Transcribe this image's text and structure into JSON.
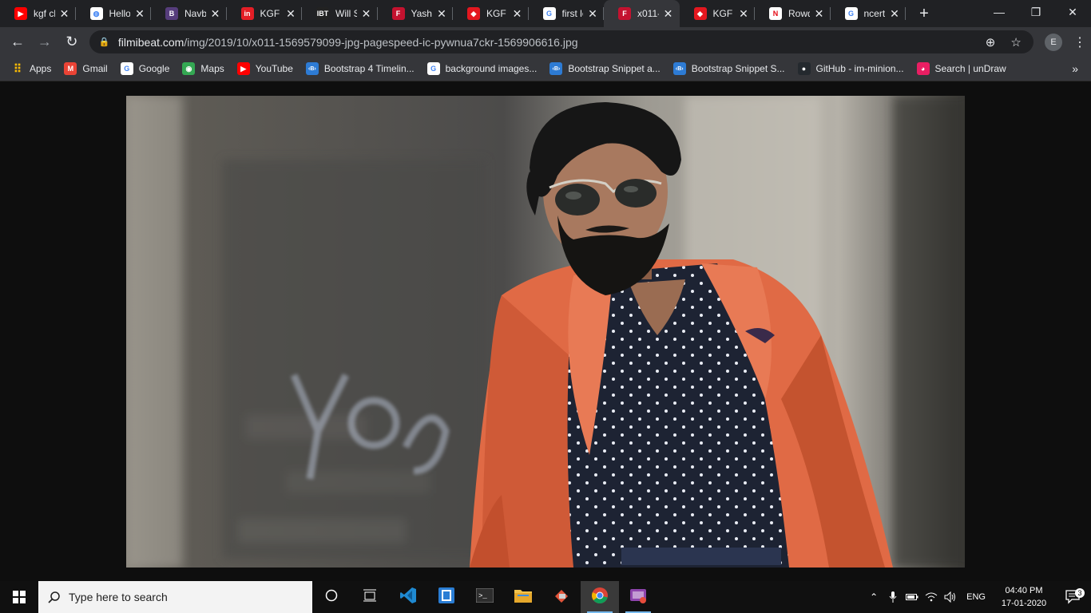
{
  "tabs": [
    {
      "title": "kgf ch",
      "icon": "youtube-icon",
      "color": "#ff0000",
      "glyph": "▶",
      "active": false
    },
    {
      "title": "Hello",
      "icon": "globe-icon",
      "color": "#ffffff",
      "glyph": "◍",
      "active": false
    },
    {
      "title": "Navb",
      "icon": "bootstrap-icon",
      "color": "#563d7c",
      "glyph": "B",
      "active": false
    },
    {
      "title": "KGF C",
      "icon": "indiatoday-icon",
      "color": "#e41e26",
      "glyph": "in",
      "active": false
    },
    {
      "title": "Will S",
      "icon": "ibt-icon",
      "color": "#222222",
      "glyph": "IBT",
      "active": false
    },
    {
      "title": "Yash C",
      "icon": "filmibeat-icon",
      "color": "#c4122f",
      "glyph": "F",
      "active": false
    },
    {
      "title": "KGF C",
      "icon": "news-icon",
      "color": "#e3171f",
      "glyph": "◆",
      "active": false
    },
    {
      "title": "first lc",
      "icon": "google-icon",
      "color": "#ffffff",
      "glyph": "G",
      "active": false
    },
    {
      "title": "x011-",
      "icon": "filmibeat-icon",
      "color": "#c4122f",
      "glyph": "F",
      "active": true
    },
    {
      "title": "KGF C",
      "icon": "news-icon",
      "color": "#e3171f",
      "glyph": "◆",
      "active": false
    },
    {
      "title": "Rowd",
      "icon": "netflix-icon",
      "color": "#ffffff",
      "glyph": "N",
      "active": false
    },
    {
      "title": "ncert",
      "icon": "google-icon",
      "color": "#ffffff",
      "glyph": "G",
      "active": false
    }
  ],
  "tab_close_glyph": "✕",
  "new_tab_glyph": "+",
  "window": {
    "minimize": "—",
    "restore": "❐",
    "close": "✕"
  },
  "toolbar": {
    "back": "←",
    "forward": "→",
    "reload": "↻",
    "url_host": "filmibeat.com",
    "url_path": "/img/2019/10/x011-1569579099-jpg-pagespeed-ic-pywnua7ckr-1569906616.jpg",
    "zoom_glyph": "⊕",
    "star_glyph": "☆",
    "profile_initial": "E",
    "menu_glyph": "⋮"
  },
  "bookmarks": [
    {
      "label": "Apps",
      "icon": "apps-grid-icon"
    },
    {
      "label": "Gmail",
      "icon": "gmail-icon"
    },
    {
      "label": "Google",
      "icon": "google-icon"
    },
    {
      "label": "Maps",
      "icon": "maps-icon"
    },
    {
      "label": "YouTube",
      "icon": "youtube-icon"
    },
    {
      "label": "Bootstrap 4 Timelin...",
      "icon": "bootsnipp-icon"
    },
    {
      "label": "background images...",
      "icon": "google-icon"
    },
    {
      "label": "Bootstrap Snippet a...",
      "icon": "bootsnipp-icon"
    },
    {
      "label": "Bootstrap Snippet S...",
      "icon": "bootsnipp-icon"
    },
    {
      "label": "GitHub - im-minion...",
      "icon": "github-icon"
    },
    {
      "label": "Search | unDraw",
      "icon": "undraw-icon"
    }
  ],
  "bookmarks_more_glyph": "»",
  "photo": {
    "subject": "man with swept-back hair, aviator sunglasses and beard wearing an orange blazer over a dark polka-dot shirt",
    "colors": {
      "blazer": "#e06a45",
      "shirt": "#1d2333",
      "wall": "#6f6c66",
      "hair": "#161616",
      "skin": "#a8795f"
    }
  },
  "taskbar": {
    "search_placeholder": "Type here to search",
    "apps": [
      {
        "name": "task-view-icon",
        "running": false
      },
      {
        "name": "taskbar-layout-icon",
        "running": false
      },
      {
        "name": "vscode-icon",
        "running": false
      },
      {
        "name": "sourcetree-icon",
        "running": false
      },
      {
        "name": "terminal-icon",
        "running": false
      },
      {
        "name": "file-explorer-icon",
        "running": false
      },
      {
        "name": "git-gui-icon",
        "running": false
      },
      {
        "name": "chrome-icon",
        "running": true
      },
      {
        "name": "screen-recorder-icon",
        "running": true
      }
    ],
    "tray": {
      "chevron": "⌃",
      "language": "ENG",
      "time": "04:40 PM",
      "date": "17-01-2020",
      "notification_count": "3"
    }
  }
}
